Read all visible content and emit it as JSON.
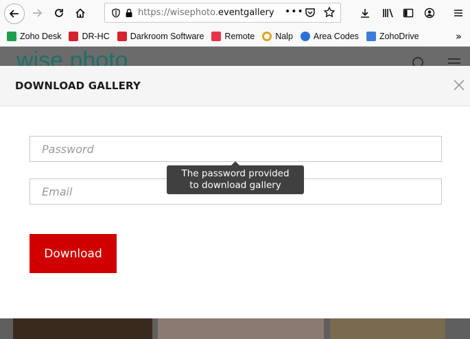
{
  "browser": {
    "url_prefix": "https://wisephoto.",
    "url_domain": "eventgallery.c",
    "url_more": "•••"
  },
  "bookmarks": [
    {
      "label": "Zoho Desk",
      "color": "#1e9e4a"
    },
    {
      "label": "DR-HC",
      "color": "#d4232c"
    },
    {
      "label": "Darkroom Software",
      "color": "#d4232c"
    },
    {
      "label": "Remote",
      "color": "#e8334a"
    },
    {
      "label": "Nalp",
      "color": "#e0a21b"
    },
    {
      "label": "Area Codes",
      "color": "#2c6fd6"
    },
    {
      "label": "ZohoDrive",
      "color": "#3b7dd8"
    }
  ],
  "site": {
    "logo": "wise.photo"
  },
  "modal": {
    "title": "DOWNLOAD GALLERY",
    "password_placeholder": "Password",
    "email_placeholder": "Email",
    "tooltip_line1": "The password provided",
    "tooltip_line2": "to download gallery",
    "download_label": "Download",
    "accent_color": "#d00000"
  }
}
